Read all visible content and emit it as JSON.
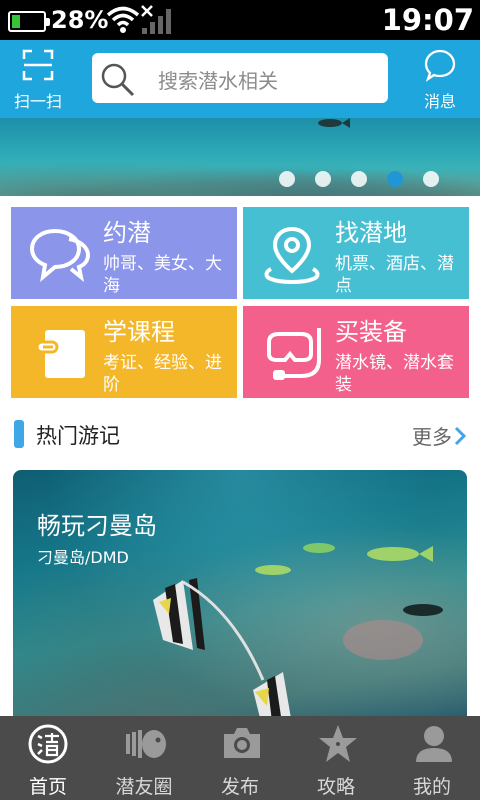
{
  "status_bar": {
    "battery_percent": 28,
    "battery_label": "28%",
    "time": "19:07"
  },
  "header": {
    "scan_label": "扫一扫",
    "search_placeholder": "搜索潜水相关",
    "message_label": "消息"
  },
  "banner": {
    "slide_count": 5,
    "active_slide_index": 3
  },
  "tiles": [
    {
      "title": "约潜",
      "subtitle": "帅哥、美女、大海",
      "icon": "chat-bubbles-icon",
      "color": "#8b95e9"
    },
    {
      "title": "找潜地",
      "subtitle": "机票、酒店、潜点",
      "icon": "location-pin-icon",
      "color": "#46bfd3"
    },
    {
      "title": "学课程",
      "subtitle": "考证、经验、进阶",
      "icon": "course-book-icon",
      "color": "#f5b72a"
    },
    {
      "title": "买装备",
      "subtitle": "潜水镜、潜水套装",
      "icon": "diving-mask-icon",
      "color": "#f4608c"
    }
  ],
  "section": {
    "title": "热门游记",
    "more_label": "更多"
  },
  "travel_card": {
    "title": "畅玩刁曼岛",
    "subtitle": "刁曼岛/DMD"
  },
  "tab_bar": {
    "items": [
      {
        "label": "首页",
        "icon": "home-qian-icon",
        "active": true
      },
      {
        "label": "潜友圈",
        "icon": "fish-icon",
        "active": false
      },
      {
        "label": "发布",
        "icon": "camera-icon",
        "active": false
      },
      {
        "label": "攻略",
        "icon": "starfish-icon",
        "active": false
      },
      {
        "label": "我的",
        "icon": "user-icon",
        "active": false
      }
    ]
  },
  "colors": {
    "header_bg": "#1fa7dd",
    "tab_bar_bg": "#4b4b4b",
    "accent": "#3fa7e5"
  }
}
